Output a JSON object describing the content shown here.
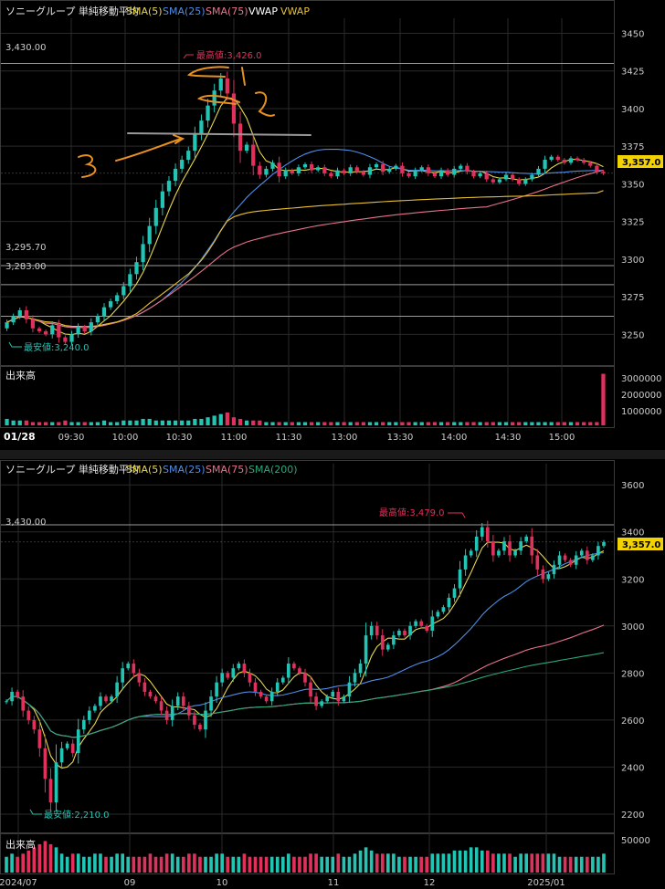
{
  "colors": {
    "bg": "#000000",
    "grid": "#2a2a2a",
    "panel_border": "#3a3a3a",
    "up": "#22c4b4",
    "down": "#e0305c",
    "sma5": "#e8d84a",
    "sma25": "#4f8de6",
    "sma75": "#e8728c",
    "sma200": "#2aa87a",
    "vwap_main": "#ffffff",
    "vwap_alt": "#e8c030",
    "last_price_bg": "#f2d200",
    "hl_line": "#9a9a9a",
    "annotation": "#e89020",
    "high_label": "#e0305c",
    "low_label": "#22c4b4"
  },
  "intraday": {
    "title": "ソニーグループ 単純移動平均",
    "legend": [
      "SMA(5)",
      "SMA(25)",
      "SMA(75)",
      "VWAP",
      "VWAP"
    ],
    "hlines": [
      "3,430.00",
      "3,295.70",
      "3,283.00"
    ],
    "high_label": "最高値:3,426.0",
    "low_label": "最安値:3,240.0",
    "last_price": "3,357.0",
    "volume_label": "出来高",
    "volume_ticks": [
      "3000000",
      "2000000",
      "1000000"
    ],
    "date": "01/28",
    "time_ticks": [
      "09:30",
      "10:00",
      "10:30",
      "11:00",
      "11:30",
      "13:00",
      "13:30",
      "14:00",
      "14:30",
      "15:00"
    ],
    "handwritten": [
      "1",
      "2",
      "3"
    ]
  },
  "daily": {
    "title": "ソニーグループ 単純移動平均",
    "legend": [
      "SMA(5)",
      "SMA(25)",
      "SMA(75)",
      "SMA(200)"
    ],
    "hline": "3,430.00",
    "high_label": "最高値:3,479.0",
    "low_label": "最安値:2,210.0",
    "last_price": "3,357.0",
    "volume_label": "出来高",
    "volume_ticks": [
      "50000"
    ],
    "date_ticks": [
      "2024/07",
      "09",
      "10",
      "11",
      "12",
      "2025/01"
    ]
  },
  "chart_data": [
    {
      "type": "candlestick",
      "title": "ソニーグループ 単純移動平均",
      "timeframe": "intraday 5-min, 01/28",
      "y_ticks": [
        3250,
        3275,
        3300,
        3325,
        3350,
        3375,
        3400,
        3425,
        3450
      ],
      "ylim": [
        3232,
        3460
      ],
      "last_price": 3357.0,
      "high": 3426.0,
      "low": 3240.0,
      "reference_lines": [
        3430.0,
        3295.7,
        3283.0,
        3262.0
      ],
      "x_ticks": [
        "09:30",
        "10:00",
        "10:30",
        "11:00",
        "11:30",
        "13:00",
        "13:30",
        "14:00",
        "14:30",
        "15:00"
      ],
      "legend": [
        "SMA(5)",
        "SMA(25)",
        "SMA(75)",
        "VWAP",
        "VWAP"
      ],
      "volume_ticks": [
        1000000,
        2000000,
        3000000
      ],
      "close": [
        3258,
        3262,
        3266,
        3260,
        3254,
        3252,
        3250,
        3256,
        3248,
        3245,
        3250,
        3255,
        3252,
        3258,
        3262,
        3268,
        3272,
        3276,
        3282,
        3290,
        3298,
        3310,
        3322,
        3334,
        3345,
        3352,
        3360,
        3366,
        3372,
        3383,
        3392,
        3402,
        3412,
        3420,
        3410,
        3390,
        3372,
        3376,
        3362,
        3356,
        3360,
        3364,
        3355,
        3359,
        3357,
        3361,
        3363,
        3359,
        3361,
        3357,
        3355,
        3359,
        3357,
        3361,
        3358,
        3356,
        3361,
        3363,
        3358,
        3360,
        3362,
        3357,
        3355,
        3359,
        3361,
        3357,
        3355,
        3359,
        3356,
        3360,
        3362,
        3358,
        3355,
        3357,
        3353,
        3351,
        3353,
        3356,
        3353,
        3350,
        3353,
        3356,
        3360,
        3366,
        3368,
        3366,
        3364,
        3367,
        3366,
        3364,
        3362,
        3358,
        3357
      ],
      "volume": [
        0.4,
        0.3,
        0.3,
        0.3,
        0.2,
        0.2,
        0.2,
        0.2,
        0.2,
        0.3,
        0.2,
        0.2,
        0.2,
        0.2,
        0.2,
        0.3,
        0.2,
        0.2,
        0.3,
        0.3,
        0.3,
        0.4,
        0.4,
        0.3,
        0.3,
        0.3,
        0.3,
        0.3,
        0.3,
        0.4,
        0.4,
        0.5,
        0.6,
        0.7,
        0.8,
        0.5,
        0.4,
        0.3,
        0.3,
        0.3,
        0.2,
        0.2,
        0.2,
        0.2,
        0.2,
        0.2,
        0.2,
        0.2,
        0.2,
        0.2,
        0.2,
        0.2,
        0.2,
        0.2,
        0.2,
        0.2,
        0.2,
        0.2,
        0.2,
        0.2,
        0.2,
        0.2,
        0.2,
        0.2,
        0.2,
        0.2,
        0.2,
        0.2,
        0.2,
        0.2,
        0.2,
        0.2,
        0.2,
        0.2,
        0.2,
        0.2,
        0.2,
        0.2,
        0.2,
        0.2,
        0.2,
        0.2,
        0.2,
        0.2,
        0.2,
        0.2,
        0.2,
        0.2,
        0.2,
        0.2,
        0.2,
        0.2,
        3.2
      ]
    },
    {
      "type": "candlestick",
      "title": "ソニーグループ 単純移動平均",
      "timeframe": "daily, 2024/07 - 2025/01",
      "y_ticks": [
        2200,
        2400,
        2600,
        2800,
        3000,
        3200,
        3400,
        3600
      ],
      "ylim": [
        2130,
        3690
      ],
      "last_price": 3357.0,
      "high": 3479.0,
      "low": 2210.0,
      "reference_lines": [
        3430.0
      ],
      "x_ticks": [
        "2024/07",
        "09",
        "10",
        "11",
        "12",
        "2025/01"
      ],
      "legend": [
        "SMA(5)",
        "SMA(25)",
        "SMA(75)",
        "SMA(200)"
      ],
      "volume_ticks": [
        50000
      ],
      "close": [
        2680,
        2720,
        2700,
        2640,
        2600,
        2560,
        2480,
        2350,
        2250,
        2420,
        2480,
        2500,
        2460,
        2560,
        2600,
        2640,
        2660,
        2700,
        2680,
        2700,
        2760,
        2820,
        2840,
        2800,
        2760,
        2720,
        2700,
        2680,
        2640,
        2600,
        2660,
        2700,
        2660,
        2620,
        2580,
        2560,
        2640,
        2700,
        2760,
        2800,
        2780,
        2820,
        2840,
        2800,
        2760,
        2720,
        2700,
        2680,
        2720,
        2760,
        2780,
        2840,
        2820,
        2800,
        2760,
        2700,
        2660,
        2680,
        2700,
        2720,
        2680,
        2700,
        2760,
        2800,
        2840,
        2960,
        3000,
        2960,
        2900,
        2920,
        2960,
        2980,
        2960,
        3000,
        3020,
        3000,
        2980,
        3040,
        3060,
        3080,
        3120,
        3160,
        3240,
        3300,
        3320,
        3380,
        3420,
        3360,
        3300,
        3320,
        3360,
        3300,
        3320,
        3360,
        3380,
        3300,
        3240,
        3200,
        3220,
        3260,
        3300,
        3280,
        3260,
        3300,
        3320,
        3280,
        3300,
        3340,
        3357
      ],
      "volume": [
        0.5,
        0.6,
        0.5,
        0.6,
        0.7,
        0.8,
        0.9,
        1.0,
        0.9,
        0.8,
        0.6,
        0.5,
        0.6,
        0.6,
        0.5,
        0.5,
        0.6,
        0.6,
        0.5,
        0.5,
        0.6,
        0.6,
        0.5,
        0.5,
        0.5,
        0.5,
        0.6,
        0.5,
        0.5,
        0.6,
        0.6,
        0.5,
        0.5,
        0.6,
        0.6,
        0.5,
        0.5,
        0.5,
        0.6,
        0.6,
        0.5,
        0.5,
        0.5,
        0.6,
        0.5,
        0.5,
        0.5,
        0.5,
        0.5,
        0.5,
        0.5,
        0.6,
        0.5,
        0.5,
        0.5,
        0.6,
        0.6,
        0.5,
        0.5,
        0.5,
        0.6,
        0.5,
        0.5,
        0.6,
        0.7,
        0.8,
        0.7,
        0.6,
        0.6,
        0.6,
        0.6,
        0.5,
        0.5,
        0.5,
        0.5,
        0.5,
        0.5,
        0.6,
        0.6,
        0.6,
        0.6,
        0.7,
        0.7,
        0.7,
        0.8,
        0.8,
        0.7,
        0.7,
        0.6,
        0.6,
        0.6,
        0.6,
        0.5,
        0.6,
        0.6,
        0.6,
        0.6,
        0.6,
        0.6,
        0.6,
        0.5,
        0.5,
        0.5,
        0.5,
        0.5,
        0.5,
        0.5,
        0.5,
        0.6
      ]
    }
  ]
}
